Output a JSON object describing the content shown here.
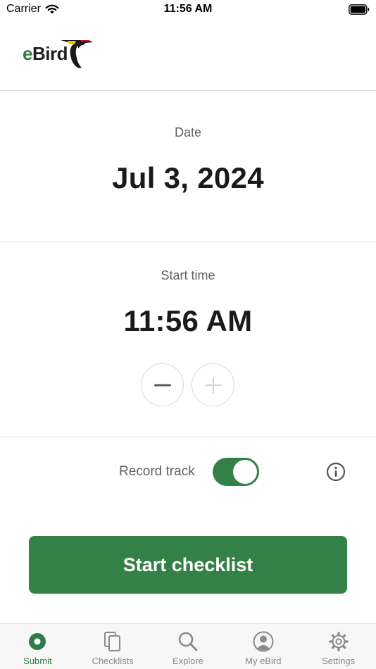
{
  "status_bar": {
    "carrier": "Carrier",
    "time": "11:56 AM"
  },
  "header": {
    "logo_prefix": "e",
    "logo_suffix": "Bird"
  },
  "date_section": {
    "label": "Date",
    "value": "Jul 3, 2024"
  },
  "time_section": {
    "label": "Start time",
    "value": "11:56 AM",
    "decrement_icon": "minus-icon",
    "increment_icon": "plus-icon"
  },
  "record_track": {
    "label": "Record track",
    "enabled": true
  },
  "start_button": {
    "label": "Start checklist"
  },
  "tabs": [
    {
      "label": "Submit",
      "icon": "record-icon",
      "active": true
    },
    {
      "label": "Checklists",
      "icon": "copy-icon",
      "active": false
    },
    {
      "label": "Explore",
      "icon": "search-icon",
      "active": false
    },
    {
      "label": "My eBird",
      "icon": "user-icon",
      "active": false
    },
    {
      "label": "Settings",
      "icon": "gear-icon",
      "active": false
    }
  ],
  "colors": {
    "brand_green": "#338147",
    "divider": "#dedede",
    "muted_text": "#5f6368"
  }
}
